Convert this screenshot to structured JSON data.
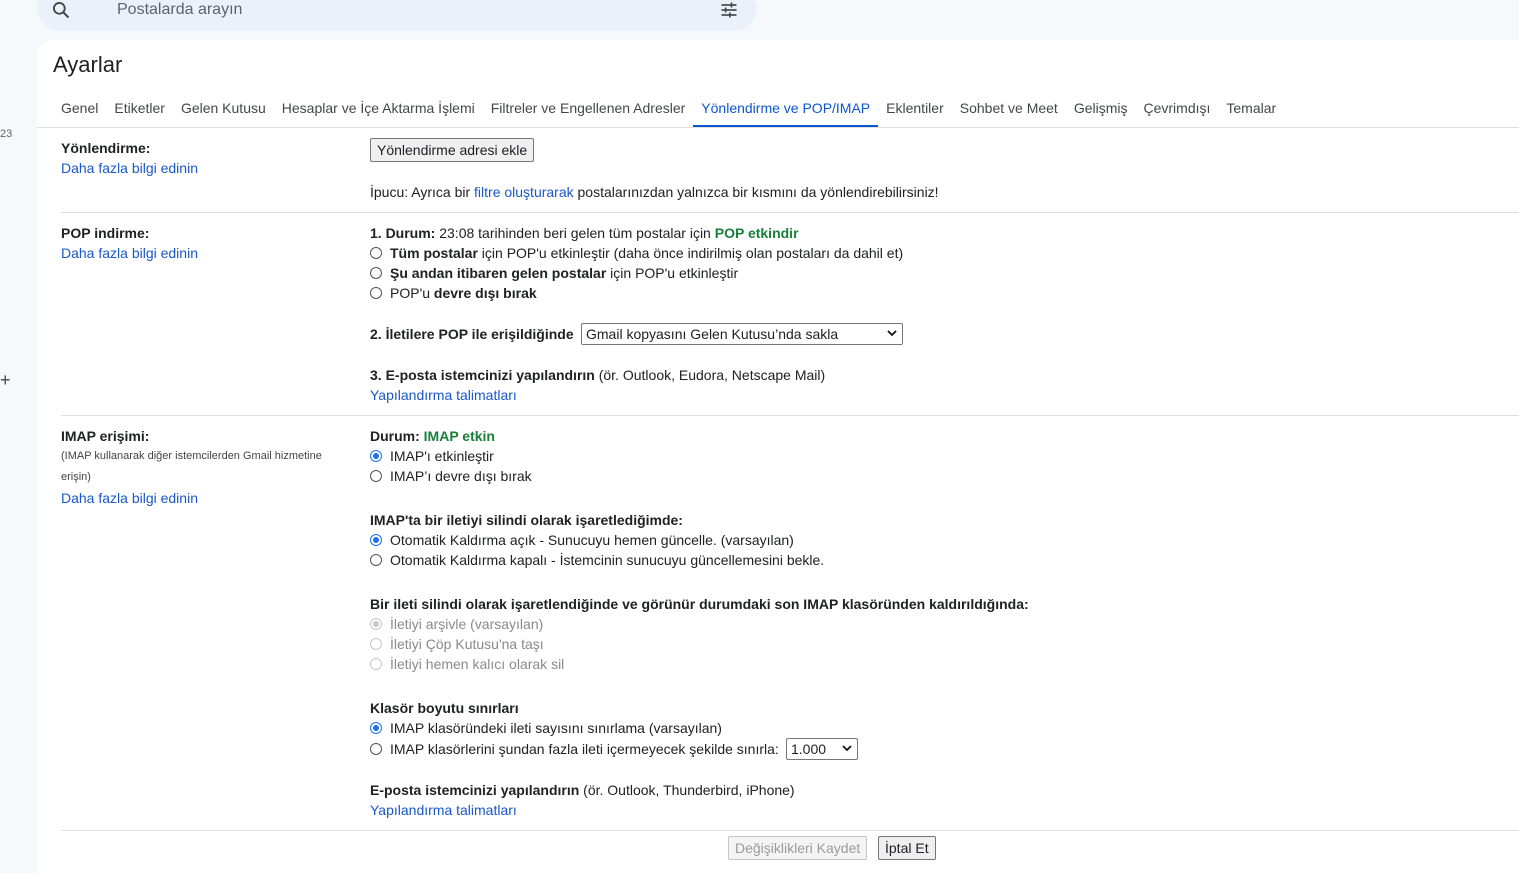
{
  "search": {
    "placeholder": "Postalarda arayın"
  },
  "rail": {
    "num": "23",
    "plus": "+"
  },
  "page": {
    "title": "Ayarlar"
  },
  "tabs": [
    {
      "label": "Genel"
    },
    {
      "label": "Etiketler"
    },
    {
      "label": "Gelen Kutusu"
    },
    {
      "label": "Hesaplar ve İçe Aktarma İşlemi"
    },
    {
      "label": "Filtreler ve Engellenen Adresler"
    },
    {
      "label": "Yönlendirme ve POP/IMAP",
      "active": true
    },
    {
      "label": "Eklentiler"
    },
    {
      "label": "Sohbet ve Meet"
    },
    {
      "label": "Gelişmiş"
    },
    {
      "label": "Çevrimdışı"
    },
    {
      "label": "Temalar"
    }
  ],
  "forwarding": {
    "label": "Yönlendirme:",
    "learn_more": "Daha fazla bilgi edinin",
    "add_button": "Yönlendirme adresi ekle",
    "tip_prefix": "İpucu: Ayrıca bir",
    "tip_link": "filtre oluşturarak",
    "tip_suffix": "postalarınızdan yalnızca bir kısmını da yönlendirebilirsiniz!"
  },
  "pop": {
    "label": "POP indirme:",
    "learn_more": "Daha fazla bilgi edinin",
    "status_bold": "1. Durum:",
    "status_text": "23:08 tarihinden beri gelen tüm postalar için",
    "status_value": "POP etkindir",
    "options": [
      {
        "bold": "Tüm postalar",
        "rest": "için POP'u etkinleştir (daha önce indirilmiş olan postaları da dahil et)"
      },
      {
        "bold": "Şu andan itibaren gelen postalar",
        "rest": "için POP'u etkinleştir"
      },
      {
        "prefix": "POP'u",
        "bold": "devre dışı bırak"
      }
    ],
    "access_label": "2. İletilere POP ile erişildiğinde",
    "access_select": "Gmail kopyasını Gelen Kutusu’nda sakla",
    "config_bold": "3. E-posta istemcinizi yapılandırın",
    "config_rest": "(ör. Outlook, Eudora, Netscape Mail)",
    "config_link": "Yapılandırma talimatları"
  },
  "imap": {
    "label": "IMAP erişimi:",
    "note": "(IMAP kullanarak diğer istemcilerden Gmail hizmetine erişin)",
    "learn_more": "Daha fazla bilgi edinin",
    "status_bold": "Durum:",
    "status_value": "IMAP etkin",
    "enable": "IMAP'ı etkinleştir",
    "disable": "IMAP’ı devre dışı bırak",
    "deleted_heading": "IMAP'ta bir iletiyi silindi olarak işaretlediğimde:",
    "expunge_on": "Otomatik Kaldırma açık - Sunucuyu hemen güncelle. (varsayılan)",
    "expunge_off": "Otomatik Kaldırma kapalı - İstemcinin sunucuyu güncellemesini bekle.",
    "expunged_heading": "Bir ileti silindi olarak işaretlendiğinde ve görünür durumdaki son IMAP klasöründen kaldırıldığında:",
    "archive": "İletiyi arşivle (varsayılan)",
    "trash": "İletiyi Çöp Kutusu'na taşı",
    "delete_forever": "İletiyi hemen kalıcı olarak sil",
    "folder_heading": "Klasör boyutu sınırları",
    "no_limit": "IMAP klasöründeki ileti sayısını sınırlama (varsayılan)",
    "limit": "IMAP klasörlerini şundan fazla ileti içermeyecek şekilde sınırla:",
    "limit_value": "1.000",
    "config_bold": "E-posta istemcinizi yapılandırın",
    "config_rest": "(ör. Outlook, Thunderbird, iPhone)",
    "config_link": "Yapılandırma talimatları"
  },
  "footer": {
    "save": "Değişiklikleri Kaydet",
    "cancel": "İptal Et"
  },
  "colors": {
    "accent": "#0b57d0",
    "link": "#1a57c9",
    "status_green": "#188038",
    "background": "#f6f8fc"
  }
}
